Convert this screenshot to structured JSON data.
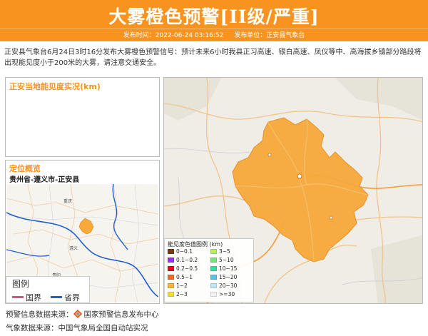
{
  "header": {
    "title": "大雾橙色预警[II级/严重]",
    "time_label": "发布时间：2022-06-24 03:16:52",
    "unit_label": "发布单位：正安县气象台",
    "color": "#f7931e"
  },
  "description": "正安县气象台6月24日3时16分发布大雾橙色预警信号：预计未来6小时我县正习高速、银白高速、凤仪等中、高海拔乡镇部分路段将出现能见度小于200米的大雾，请注意交通安全。",
  "visibility_panel": {
    "title": "正安当地能见度实况(km)"
  },
  "location_panel": {
    "title": "定位概览",
    "subtitle": "贵州省-遵义市-正安县"
  },
  "overview_map_labels": [
    {
      "name": "重庆"
    },
    {
      "name": "遵义"
    },
    {
      "name": "贵阳"
    }
  ],
  "overview_legend": {
    "title": "图例",
    "items": [
      {
        "label": "国界",
        "color": "#d9507a"
      },
      {
        "label": "省界",
        "color": "#1f5fd0"
      }
    ]
  },
  "visibility_legend": {
    "title": "能见度色值图例 (km)",
    "items": [
      {
        "label": "0~0.1",
        "color": "#7a3b10"
      },
      {
        "label": "0.1~0.2",
        "color": "#9b30ff"
      },
      {
        "label": "0.2~0.5",
        "color": "#e8001c"
      },
      {
        "label": "0.5~1",
        "color": "#ff6a1a"
      },
      {
        "label": "1~2",
        "color": "#f7b23b"
      },
      {
        "label": "2~3",
        "color": "#f2df34"
      },
      {
        "label": "3~5",
        "color": "#b7f05a"
      },
      {
        "label": "5~10",
        "color": "#7be37b"
      },
      {
        "label": "10~15",
        "color": "#34e0a0"
      },
      {
        "label": "15~20",
        "color": "#52c5e8"
      },
      {
        "label": "20~30",
        "color": "#bfe8f7"
      },
      {
        "label": ">=30",
        "color": "#f2f2f2"
      }
    ]
  },
  "warning_area_color": "#f7a93a",
  "footer": {
    "source1_label": "预警信息数据来源：",
    "source1_value": "国家预警信息发布中心",
    "source2": "气象数据来源：中国气象局全国自动站实况"
  }
}
